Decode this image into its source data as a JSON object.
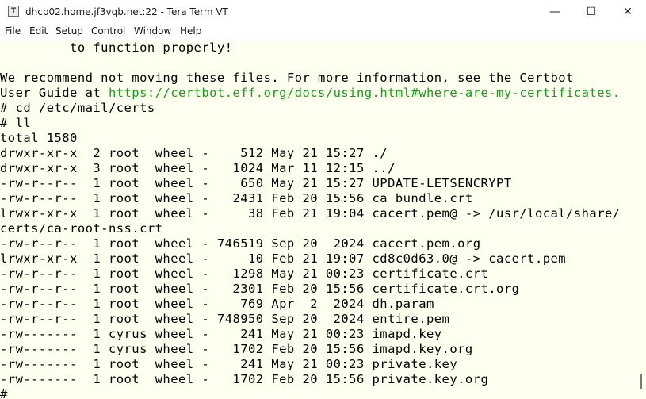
{
  "window": {
    "title": "dhcp02.home.jf3vqb.net:22 - Tera Term VT",
    "icon_name": "tera-term-app-icon",
    "controls": {
      "minimize": "—",
      "maximize": "☐",
      "close": "✕"
    }
  },
  "menu": [
    "File",
    "Edit",
    "Setup",
    "Control",
    "Window",
    "Help"
  ],
  "colors": {
    "terminal_bg": "#fffff0",
    "text": "#000000",
    "link": "#15a015"
  },
  "terminal": {
    "lines": [
      "         to function properly!",
      "",
      "We recommend not moving these files. For more information, see the Certbot",
      "User Guide at ",
      "# cd /etc/mail/certs",
      "# ll",
      "total 1580",
      "drwxr-xr-x  2 root  wheel -    512 May 21 15:27 ./",
      "drwxr-xr-x  3 root  wheel -   1024 Mar 11 12:15 ../",
      "-rw-r--r--  1 root  wheel -    650 May 21 15:27 UPDATE-LETSENCRYPT",
      "-rw-r--r--  1 root  wheel -   2431 Feb 20 15:56 ca_bundle.crt",
      "lrwxr-xr-x  1 root  wheel -     38 Feb 21 19:04 cacert.pem@ -> /usr/local/share/",
      "certs/ca-root-nss.crt",
      "-rw-r--r--  1 root  wheel - 746519 Sep 20  2024 cacert.pem.org",
      "lrwxr-xr-x  1 root  wheel -     10 Feb 21 19:07 cd8c0d63.0@ -> cacert.pem",
      "-rw-r--r--  1 root  wheel -   1298 May 21 00:23 certificate.crt",
      "-rw-r--r--  1 root  wheel -   2301 Feb 20 15:56 certificate.crt.org",
      "-rw-r--r--  1 root  wheel -    769 Apr  2  2024 dh.param",
      "-rw-r--r--  1 root  wheel - 748950 Sep 20  2024 entire.pem",
      "-rw-------  1 cyrus wheel -    241 May 21 00:23 imapd.key",
      "-rw-------  1 cyrus wheel -   1702 Feb 20 15:56 imapd.key.org",
      "-rw-------  1 root  wheel -    241 May 21 00:23 private.key",
      "-rw-------  1 root  wheel -   1702 Feb 20 15:56 private.key.org",
      "#"
    ],
    "link_text": "https://certbot.eff.org/docs/using.html#where-are-my-certificates."
  }
}
